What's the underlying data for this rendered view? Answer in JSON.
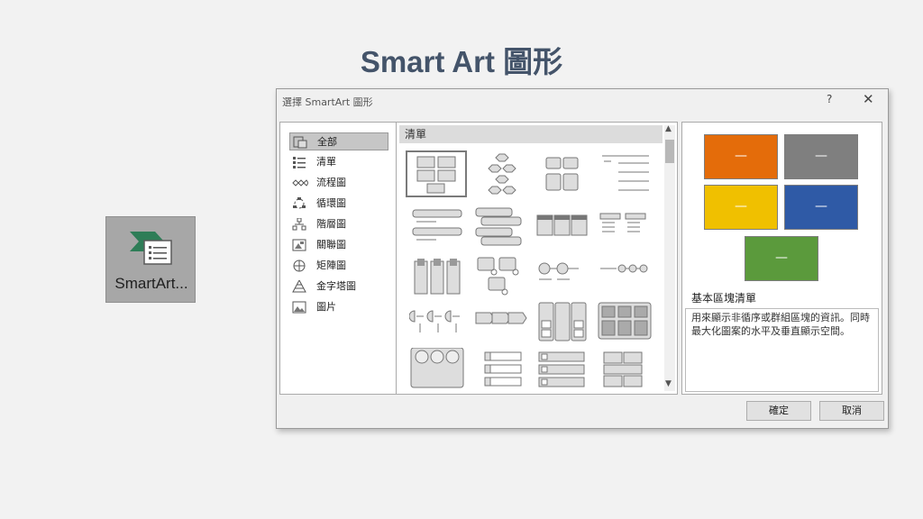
{
  "slide": {
    "title": "Smart Art 圖形"
  },
  "ribbon_button": {
    "label": "SmartArt...",
    "icon": "smartart-icon"
  },
  "dialog": {
    "title": "選擇 SmartArt 圖形",
    "help": "?",
    "close": "✕",
    "categories": [
      {
        "label": "全部",
        "icon": "all-icon",
        "selected": true
      },
      {
        "label": "清單",
        "icon": "list-icon"
      },
      {
        "label": "流程圖",
        "icon": "process-icon"
      },
      {
        "label": "循環圖",
        "icon": "cycle-icon"
      },
      {
        "label": "階層圖",
        "icon": "hierarchy-icon"
      },
      {
        "label": "關聯圖",
        "icon": "relationship-icon"
      },
      {
        "label": "矩陣圖",
        "icon": "matrix-icon"
      },
      {
        "label": "金字塔圖",
        "icon": "pyramid-icon"
      },
      {
        "label": "圖片",
        "icon": "picture-icon"
      }
    ],
    "gallery": {
      "header": "清單"
    },
    "preview": {
      "box_text": "—",
      "box_colors": [
        "#e46c0a",
        "#7f7f7f",
        "#f0c000",
        "#2f5aa6",
        "#5b9a3c"
      ],
      "layout_name": "基本區塊清單",
      "description": "用來顯示非循序或群組區塊的資訊。同時最大化圖案的水平及垂直顯示空間。"
    },
    "buttons": {
      "ok": "確定",
      "cancel": "取消"
    }
  }
}
